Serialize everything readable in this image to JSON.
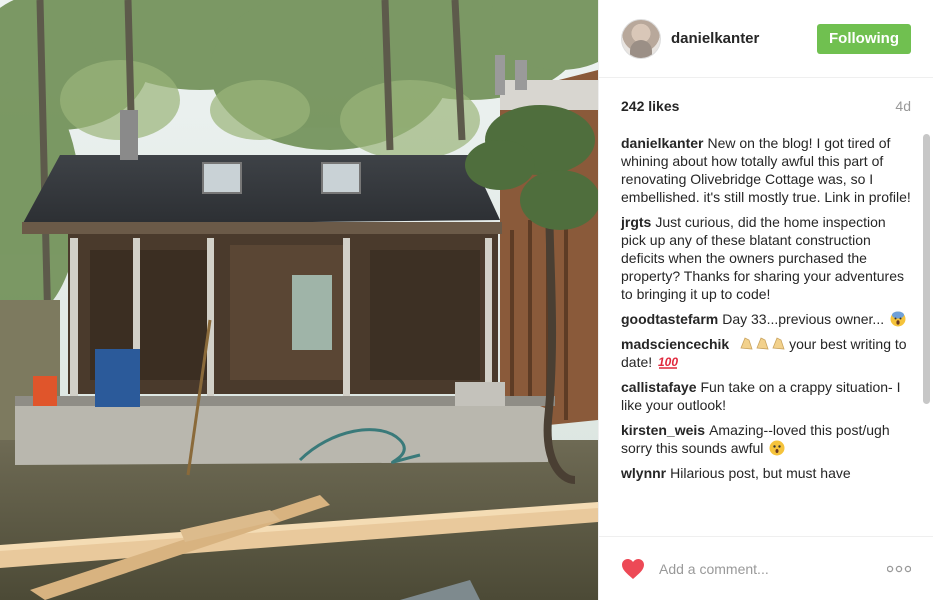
{
  "post": {
    "photo_alt": "",
    "header": {
      "username": "danielkanter",
      "follow_button": "Following",
      "avatar_icon": "profile-photo-avatar"
    },
    "stats": {
      "likes": "242 likes",
      "age": "4d"
    },
    "comments": [
      {
        "author": "danielkanter",
        "text": "New on the blog! I got tired of whining about how totally awful this part of renovating Olivebridge Cottage was, so I embellished. it's still mostly true. Link in profile!"
      },
      {
        "author": "jrgts",
        "text": "Just curious, did the home inspection pick up any of these blatant construction deficits when the owners purchased the property? Thanks for sharing your adventures to bringing it up to code!"
      },
      {
        "author": "goodtastefarm",
        "text": "Day 33...previous owner...",
        "emoji_after": "screaming-face-emoji"
      },
      {
        "author": "madsciencechik",
        "text_before": "",
        "emoji_before": "clapping-hands-emoji",
        "text": "your best writing to date!",
        "emoji_after": "hundred-points-emoji"
      },
      {
        "author": "callistafaye",
        "text": "Fun take on a crappy situation- I like your outlook!"
      },
      {
        "author": "kirsten_weis",
        "text": "Amazing--loved this post/ugh sorry this sounds awful",
        "emoji_after": "astonished-face-emoji"
      },
      {
        "author": "wlynnr",
        "text": "Hilarious post, but must have"
      }
    ],
    "footer": {
      "comment_placeholder": "Add a comment...",
      "more_label": "ooo",
      "heart_color": "#ed4956"
    },
    "colors": {
      "follow_green": "#70c050",
      "muted_text": "#999999"
    }
  }
}
